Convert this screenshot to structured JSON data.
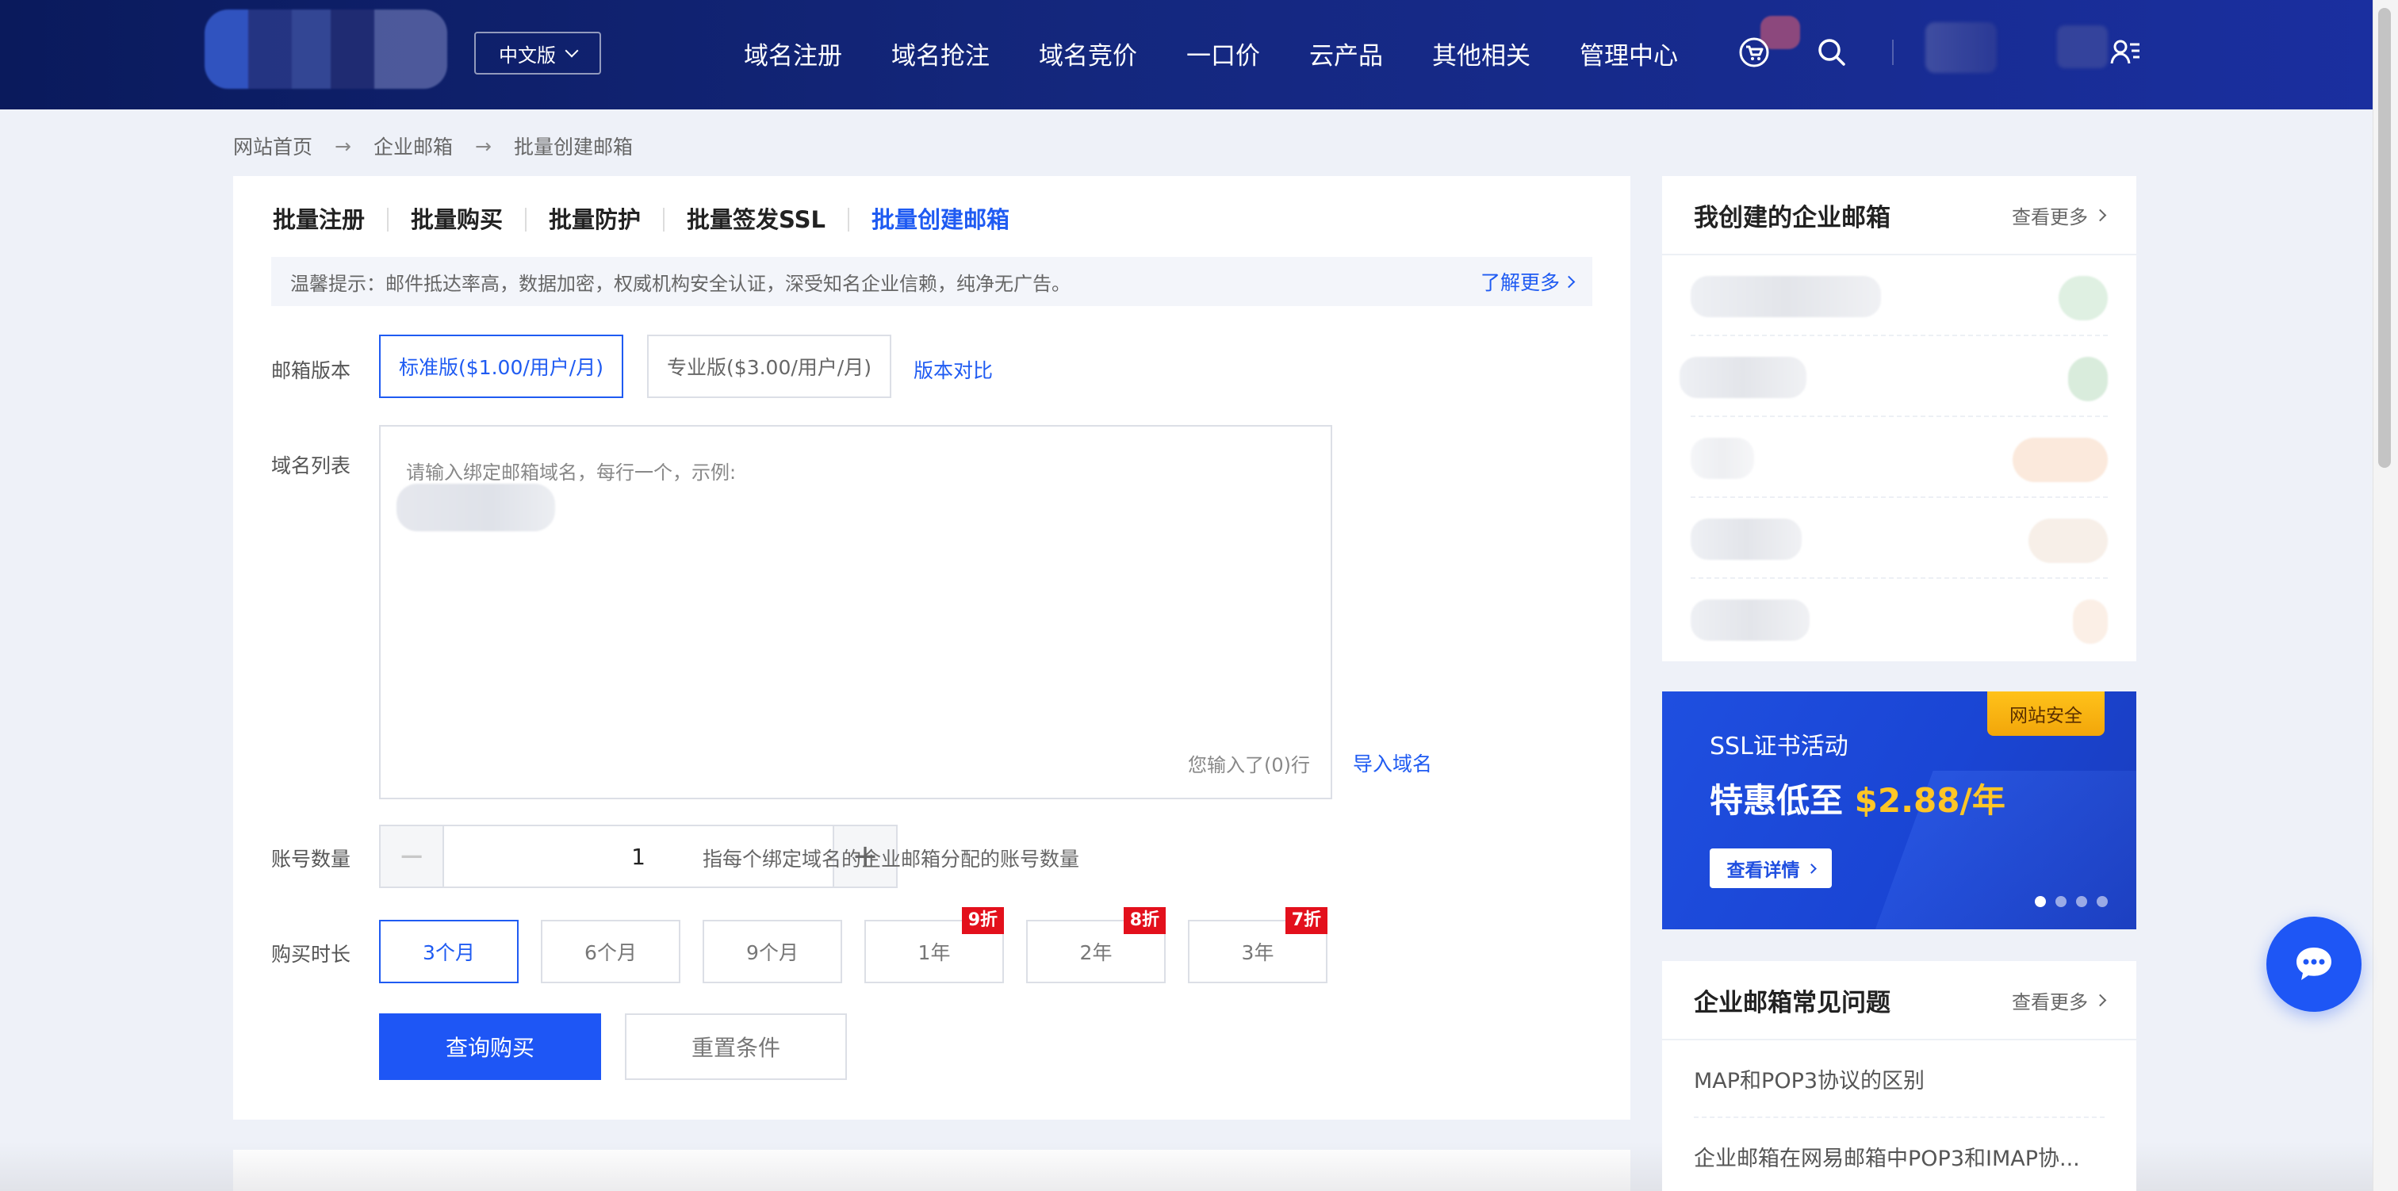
{
  "header": {
    "lang": "中文版",
    "nav": [
      "域名注册",
      "域名抢注",
      "域名竞价",
      "一口价",
      "云产品",
      "其他相关",
      "管理中心"
    ]
  },
  "breadcrumb": [
    "网站首页",
    "企业邮箱",
    "批量创建邮箱"
  ],
  "breadcrumb_sep": "→",
  "tabs": [
    "批量注册",
    "批量购买",
    "批量防护",
    "批量签发SSL",
    "批量创建邮箱"
  ],
  "tip": {
    "text": "温馨提示：邮件抵达率高，数据加密，权威机构安全认证，深受知名企业信赖，纯净无广告。",
    "more": "了解更多"
  },
  "form": {
    "version_label": "邮箱版本",
    "versions": [
      "标准版($1.00/用户/月)",
      "专业版($3.00/用户/月)"
    ],
    "compare_link": "版本对比",
    "domain_label": "域名列表",
    "domain_placeholder": "请输入绑定邮箱域名，每行一个，示例:",
    "domain_counter": "您输入了(0)行",
    "import_link": "导入域名",
    "account_label": "账号数量",
    "account_value": "1",
    "account_hint": "指每个绑定域名的企业邮箱分配的账号数量",
    "period_label": "购买时长",
    "periods": [
      {
        "label": "3个月",
        "badge": ""
      },
      {
        "label": "6个月",
        "badge": ""
      },
      {
        "label": "9个月",
        "badge": ""
      },
      {
        "label": "1年",
        "badge": "9折"
      },
      {
        "label": "2年",
        "badge": "8折"
      },
      {
        "label": "3年",
        "badge": "7折"
      }
    ],
    "submit": "查询购买",
    "reset": "重置条件"
  },
  "side": {
    "my_mail_title": "我创建的企业邮箱",
    "more": "查看更多",
    "faq_title": "企业邮箱常见问题",
    "faq": [
      "MAP和POP3协议的区别",
      "企业邮箱在网易邮箱中POP3和IMAP协..."
    ]
  },
  "banner": {
    "ribbon": "网站安全",
    "title": "SSL证书活动",
    "headline": "特惠低至",
    "price": "$2.88/年",
    "cta": "查看详情"
  },
  "colors": {
    "accent": "#1f5bf2",
    "header": "#14277d",
    "discount": "#e3101c",
    "banner_price": "#ffc626"
  }
}
